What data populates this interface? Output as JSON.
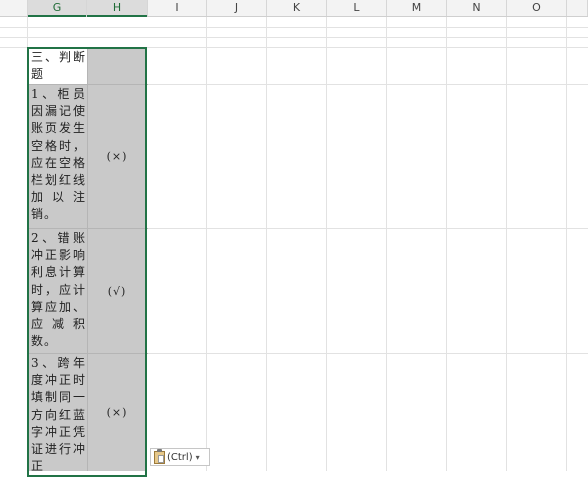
{
  "columns": [
    "G",
    "H",
    "I",
    "J",
    "K",
    "L",
    "M",
    "N",
    "O"
  ],
  "cells": {
    "section_title": "三、判断题",
    "q1_text": "1、柜员因漏记使账页发生空格时，应在空格栏划红线加以注销。",
    "q1_answer": "(×)",
    "q2_text": "2、错账冲正影响利息计算时，应计算应加、应减积数。",
    "q2_answer": "(√)",
    "q3_text": "3、跨年度冲正时填制同一方向红蓝字冲正凭证进行冲正",
    "q3_answer": "(×)"
  },
  "paste_options": {
    "label": "(Ctrl)",
    "icon": "clipboard-icon",
    "caret_icon": "chevron-down-icon"
  },
  "colors": {
    "selection": "#217346",
    "shaded_fill": "#c9c9c9"
  }
}
